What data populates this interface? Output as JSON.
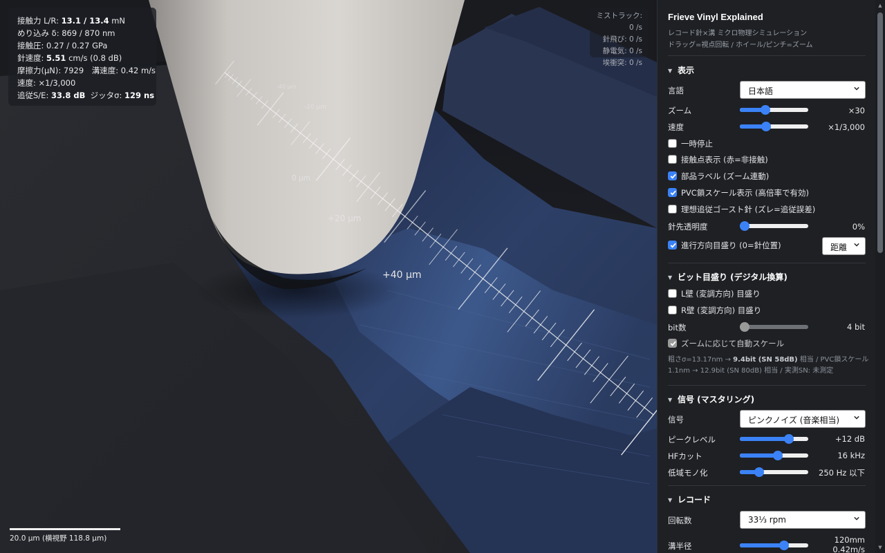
{
  "stats": {
    "line1_label": "接触力 L/R:",
    "line1_value": "13.1 / 13.4",
    "line1_unit": "mN",
    "line2": "めり込み δ: 869 / 870 nm",
    "line3": "接触圧: 0.27 / 0.27 GPa",
    "line4_label": "針速度:",
    "line4_value": "5.51",
    "line4_rest": "cm/s (0.8 dB)",
    "line5": "摩擦力(μN): 7929　溝速度: 0.42 m/s",
    "line6": "速度: ×1/3,000",
    "line7_label": "追従S/E:",
    "line7_value": "33.8 dB",
    "line7_label2": "ジッタσ:",
    "line7_value2": "129 ns"
  },
  "counters": {
    "mistrack": "ミストラック: 0 /s",
    "skip": "針飛び: 0 /s",
    "static": "静電気: 0 /s",
    "dust": "埃衝突: 0 /s"
  },
  "scene": {
    "ruler_labels": [
      "-40 μm",
      "-20 μm",
      "0 μm",
      "+20 μm",
      "+40 μm"
    ],
    "colors": {
      "groove": "#2b3a5e",
      "groove_light": "#4a6ea8",
      "stylus": "#d2cfcb",
      "ruler": "#ffffff"
    }
  },
  "scalebar": {
    "label": "20.0 μm (横視野 118.8 μm)"
  },
  "panel": {
    "title": "Frieve Vinyl Explained",
    "subtitle1": "レコード針×溝 ミクロ物理シミュレーション",
    "subtitle2": "ドラッグ=視点回転 / ホイール/ピンチ=ズーム",
    "display": {
      "header": "表示",
      "language_label": "言語",
      "language_value": "日本語",
      "zoom_label": "ズーム",
      "zoom_value": "×30",
      "zoom_level": 0.35,
      "speed_label": "速度",
      "speed_value": "×1/3,000",
      "speed_level": 0.37,
      "pause_label": "一時停止",
      "pause_checked": false,
      "contact_label": "接触点表示 (赤=非接触)",
      "contact_checked": false,
      "parts_label": "部品ラベル (ズーム連動)",
      "parts_checked": true,
      "pvc_label": "PVC鎖スケール表示 (高倍率で有効)",
      "pvc_checked": true,
      "ghost_label": "理想追従ゴースト針 (ズレ=追従誤差)",
      "ghost_checked": false,
      "tip_opacity_label": "針先透明度",
      "tip_opacity_value": "0%",
      "tip_opacity_level": 0.0,
      "ruler_label": "進行方向目盛り (0=針位置)",
      "ruler_checked": true,
      "ruler_mode": "距離"
    },
    "bits": {
      "header": "ビット目盛り (デジタル換算)",
      "lwall_label": "L壁 (変調方向) 目盛り",
      "lwall_checked": false,
      "rwall_label": "R壁 (変調方向) 目盛り",
      "rwall_checked": false,
      "bits_label": "bit数",
      "bits_value": "4 bit",
      "bits_level": 0.0,
      "autoscale_label": "ズームに応じて自動スケール",
      "autoscale_checked": true,
      "note1_a": "粗さσ=13.17nm → ",
      "note1_b": "9.4bit (SN 58dB)",
      "note1_c": " 相当 / PVC鎖スケール",
      "note2": "1.1nm → 12.9bit (SN 80dB) 相当 / 実測SN: 未測定"
    },
    "signal": {
      "header": "信号 (マスタリング)",
      "signal_label": "信号",
      "signal_value": "ピンクノイズ (音楽相当)",
      "peak_label": "ピークレベル",
      "peak_value": "+12 dB",
      "peak_level": 0.75,
      "hf_label": "HFカット",
      "hf_value": "16 kHz",
      "hf_level": 0.56,
      "mono_label": "低域モノ化",
      "mono_value": "250 Hz 以下",
      "mono_level": 0.25
    },
    "record": {
      "header": "レコード",
      "rpm_label": "回転数",
      "rpm_value": "33⅓ rpm",
      "radius_label": "溝半径",
      "radius_value1": "120mm",
      "radius_value2": "0.42m/s",
      "radius_level": 0.67
    }
  }
}
